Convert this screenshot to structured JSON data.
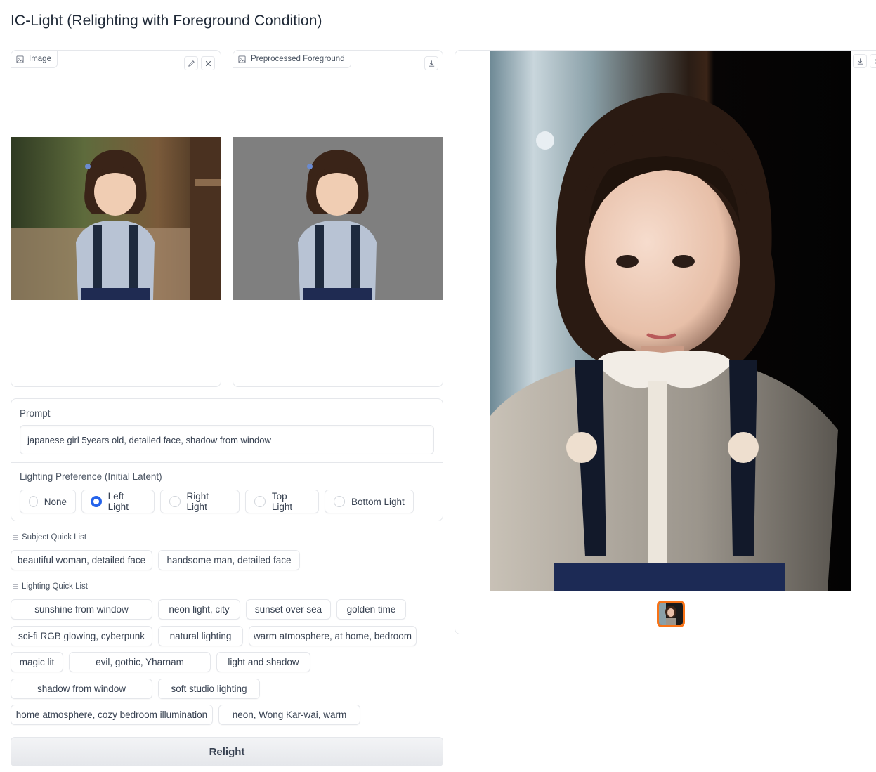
{
  "app": {
    "title": "IC-Light (Relighting with Foreground Condition)"
  },
  "input_image": {
    "label": "Image"
  },
  "preprocessed": {
    "label": "Preprocessed Foreground"
  },
  "prompt": {
    "label": "Prompt",
    "value": "japanese girl 5years old, detailed face, shadow from window"
  },
  "lighting_preference": {
    "label": "Lighting Preference (Initial Latent)",
    "options": [
      "None",
      "Left Light",
      "Right Light",
      "Top Light",
      "Bottom Light"
    ],
    "selected": "Left Light"
  },
  "subject_quick_list": {
    "label": "Subject Quick List",
    "items": [
      "beautiful woman, detailed face",
      "handsome man, detailed face"
    ]
  },
  "lighting_quick_list": {
    "label": "Lighting Quick List",
    "items": [
      "sunshine from window",
      "neon light, city",
      "sunset over sea",
      "golden time",
      "sci-fi RGB glowing, cyberpunk",
      "natural lighting",
      "warm atmosphere, at home, bedroom",
      "magic lit",
      "evil, gothic, Yharnam",
      "light and shadow",
      "shadow from window",
      "soft studio lighting",
      "home atmosphere, cozy bedroom illumination",
      "neon, Wong Kar-wai, warm"
    ]
  },
  "relight_button": {
    "label": "Relight"
  },
  "colors": {
    "accent": "#2563eb",
    "selected_thumb": "#f97316",
    "border": "#e5e7eb"
  }
}
